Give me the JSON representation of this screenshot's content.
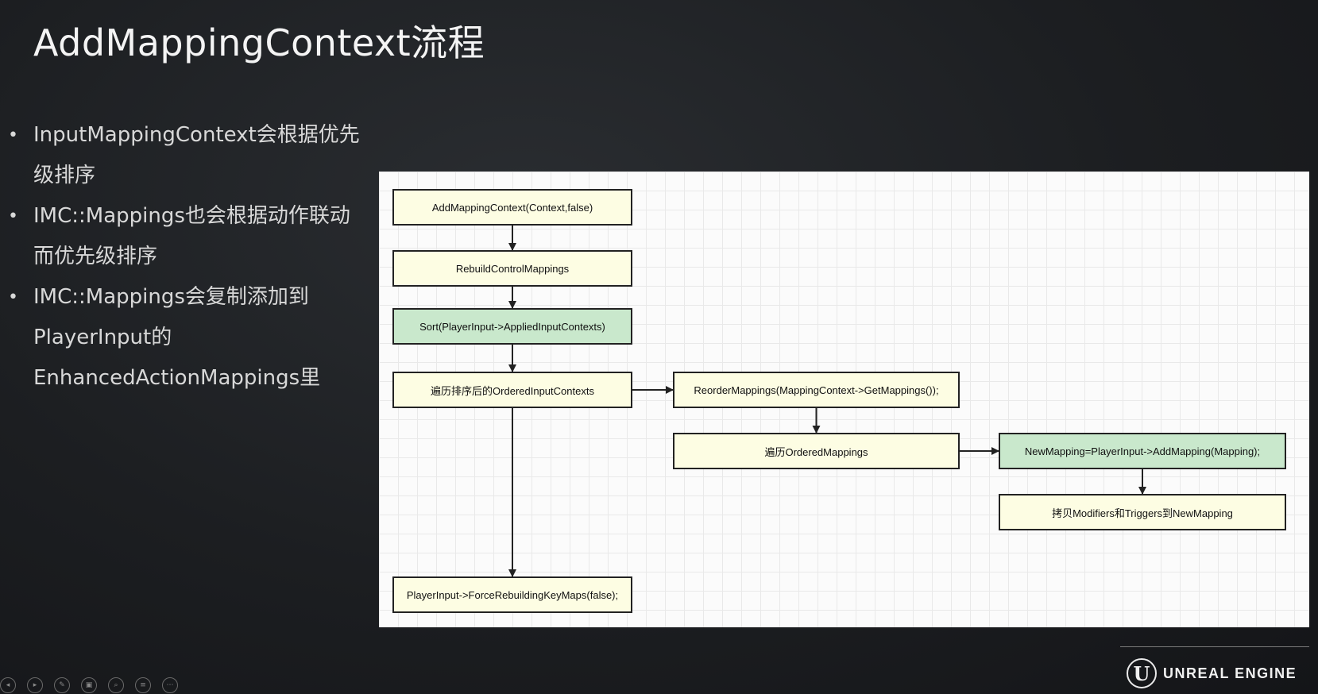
{
  "slide": {
    "title": "AddMappingContext流程",
    "bullets": [
      "InputMappingContext会根据优先级排序",
      "IMC::Mappings也会根据动作联动而优先级排序",
      "IMC::Mappings会复制添加到PlayerInput的EnhancedActionMappings里"
    ]
  },
  "diagram": {
    "nodes": [
      {
        "id": "n1",
        "label": "AddMappingContext(Context,false)",
        "fill": "#fdfde3"
      },
      {
        "id": "n2",
        "label": "RebuildControlMappings",
        "fill": "#fdfde3"
      },
      {
        "id": "n3",
        "label": "Sort(PlayerInput->AppliedInputContexts)",
        "fill": "#c9e8cc"
      },
      {
        "id": "n4",
        "label": "遍历排序后的OrderedInputContexts",
        "fill": "#fdfde3"
      },
      {
        "id": "n5",
        "label": "ReorderMappings(MappingContext->GetMappings());",
        "fill": "#fdfde3"
      },
      {
        "id": "n6",
        "label": "遍历OrderedMappings",
        "fill": "#fdfde3"
      },
      {
        "id": "n7",
        "label": "NewMapping=PlayerInput->AddMapping(Mapping);",
        "fill": "#c9e8cc"
      },
      {
        "id": "n8",
        "label": "拷贝Modifiers和Triggers到NewMapping",
        "fill": "#fdfde3"
      },
      {
        "id": "n9",
        "label": "PlayerInput->ForceRebuildingKeyMaps(false);",
        "fill": "#fdfde3"
      }
    ],
    "edges": [
      [
        "n1",
        "n2"
      ],
      [
        "n2",
        "n3"
      ],
      [
        "n3",
        "n4"
      ],
      [
        "n4",
        "n5"
      ],
      [
        "n5",
        "n6"
      ],
      [
        "n6",
        "n7"
      ],
      [
        "n7",
        "n8"
      ],
      [
        "n4",
        "n9"
      ]
    ]
  },
  "toolbar": {
    "icons": [
      "prev-icon",
      "play-icon",
      "pen-icon",
      "copy-icon",
      "zoom-icon",
      "menu-icon",
      "more-icon"
    ]
  },
  "brand": {
    "logo_text": "UNREAL ENGINE",
    "logo_glyph": "U"
  }
}
